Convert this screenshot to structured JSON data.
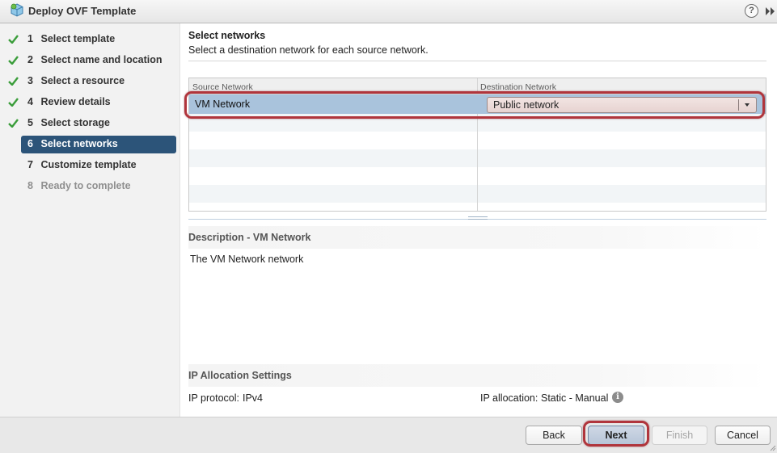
{
  "window": {
    "title": "Deploy OVF Template",
    "help_glyph": "?",
    "icons": [
      "vm-template-icon",
      "help-icon",
      "expand-icon"
    ]
  },
  "steps": [
    {
      "num": "1",
      "label": "Select template",
      "state": "completed"
    },
    {
      "num": "2",
      "label": "Select name and location",
      "state": "completed"
    },
    {
      "num": "3",
      "label": "Select a resource",
      "state": "completed"
    },
    {
      "num": "4",
      "label": "Review details",
      "state": "completed"
    },
    {
      "num": "5",
      "label": "Select storage",
      "state": "completed"
    },
    {
      "num": "6",
      "label": "Select networks",
      "state": "active"
    },
    {
      "num": "7",
      "label": "Customize template",
      "state": "pending"
    },
    {
      "num": "8",
      "label": "Ready to complete",
      "state": "disabled"
    }
  ],
  "page": {
    "title": "Select networks",
    "subtitle": "Select a destination network for each source network."
  },
  "network_table": {
    "columns": [
      "Source Network",
      "Destination Network"
    ],
    "rows": [
      {
        "source": "VM Network",
        "destination": "Public network"
      }
    ]
  },
  "description": {
    "title": "Description - VM Network",
    "text": "The VM Network network"
  },
  "ip_allocation": {
    "title": "IP Allocation Settings",
    "protocol_label": "IP protocol:",
    "protocol_value": "IPv4",
    "allocation_label": "IP allocation:",
    "allocation_value": "Static - Manual",
    "info_glyph": "i"
  },
  "buttons": {
    "back": "Back",
    "next": "Next",
    "finish": "Finish",
    "cancel": "Cancel"
  },
  "colors": {
    "active_step": "#2c5479",
    "selected_row": "#a9c3dc",
    "check": "#3a9d3a",
    "highlight_ring": "#b0353c",
    "primary_button": "#b7c5d8"
  }
}
